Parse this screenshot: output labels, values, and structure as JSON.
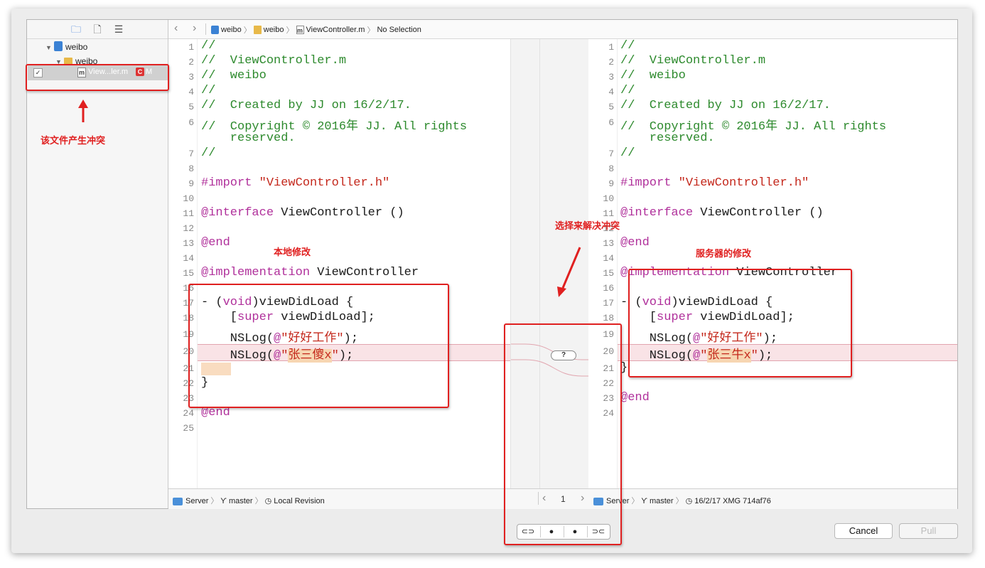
{
  "sidebar": {
    "tabs": [
      {
        "icon": "folder-icon",
        "glyph": "🗀"
      },
      {
        "icon": "document-icon",
        "glyph": "🗋"
      },
      {
        "icon": "list-icon",
        "glyph": "☰"
      }
    ],
    "tree": [
      {
        "label": "weibo",
        "icon": "project-icon"
      },
      {
        "label": "weibo",
        "icon": "folder-icon"
      }
    ],
    "selected_file": {
      "label": "View...ler.m",
      "badge": "C",
      "status": "M",
      "checked": "✓"
    }
  },
  "jumpbar": {
    "back": "‹",
    "forward": "›",
    "crumbs": [
      "weibo",
      "weibo",
      "ViewController.m",
      "No Selection"
    ]
  },
  "left_pane": {
    "line_numbers": [
      "1",
      "2",
      "3",
      "4",
      "5",
      "6",
      "",
      "7",
      "8",
      "9",
      "10",
      "11",
      "12",
      "13",
      "14",
      "15",
      "16",
      "17",
      "18",
      "19",
      "20",
      "21",
      "22",
      "23",
      "24",
      "25"
    ]
  },
  "right_pane": {
    "line_numbers": [
      "1",
      "2",
      "3",
      "4",
      "5",
      "6",
      "",
      "7",
      "8",
      "9",
      "10",
      "11",
      "12",
      "13",
      "14",
      "15",
      "16",
      "17",
      "18",
      "19",
      "20",
      "21",
      "22",
      "23",
      "24"
    ]
  },
  "code_common": {
    "c1": "//",
    "c2": "//  ViewController.m",
    "c3": "//  weibo",
    "c4": "//",
    "c5": "//  Created by JJ on 16/2/17.",
    "c6a": "//  Copyright © 2016年 JJ. All rights",
    "c6b": "    reserved.",
    "c7": "//",
    "import_kw": "#import ",
    "import_str": "\"ViewController.h\"",
    "interface_kw": "@interface",
    "interface_rest": " ViewController ()",
    "end_kw": "@end",
    "impl_kw": "@implementation",
    "impl_rest": " ViewController",
    "vdl_a": "- (",
    "vdl_kw": "void",
    "vdl_b": ")viewDidLoad {",
    "sup_a": "    [",
    "sup_kw": "super",
    "sup_b": " viewDidLoad];",
    "log_a": "    NSLog(",
    "log_at": "@",
    "log1_str": "\"好好工作\"",
    "log_end": ");",
    "close": "}"
  },
  "left_conflict_str": "张三傻x",
  "right_conflict_str": "张三牛x",
  "quote": "\"",
  "merge_button": "?",
  "left_status": {
    "server": "Server",
    "branch": "master",
    "revision": "Local Revision"
  },
  "pager": {
    "prev": "‹",
    "page": "1",
    "next": "›"
  },
  "right_status": {
    "server": "Server",
    "branch": "master",
    "revision": "16/2/17  XMG  714af76"
  },
  "resolve_buttons": [
    "⊂⊃",
    "●",
    "●",
    "⊃⊂"
  ],
  "buttons": {
    "cancel": "Cancel",
    "pull": "Pull"
  },
  "annotations": {
    "file_conflict": "该文件产生冲突",
    "local_change": "本地修改",
    "choose_resolve": "选择来解决冲突",
    "server_change": "服务器的修改"
  },
  "colors": {
    "conflict_ribbon": "#f9e3e6",
    "annotation_red": "#e02020",
    "comment_green": "#2d8a2d",
    "keyword_purple": "#b0309b",
    "string_red": "#c4281c"
  }
}
